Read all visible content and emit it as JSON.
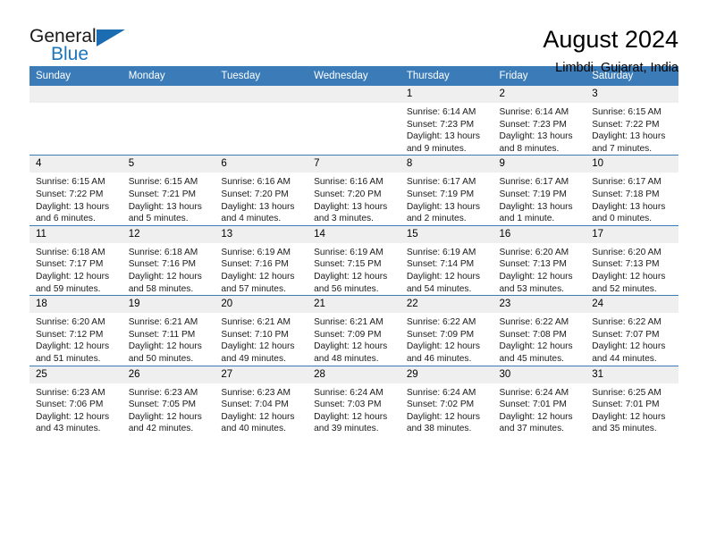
{
  "brand": {
    "name_part1": "General",
    "name_part2": "Blue"
  },
  "header": {
    "title": "August 2024",
    "subtitle": "Limbdi, Gujarat, India"
  },
  "weekday_headers": [
    "Sunday",
    "Monday",
    "Tuesday",
    "Wednesday",
    "Thursday",
    "Friday",
    "Saturday"
  ],
  "colors": {
    "header_blue": "#3b7cb8",
    "logo_blue": "#1b75bb",
    "daynum_bg": "#efefef"
  },
  "weeks": [
    [
      {
        "day": "",
        "empty": true
      },
      {
        "day": "",
        "empty": true
      },
      {
        "day": "",
        "empty": true
      },
      {
        "day": "",
        "empty": true
      },
      {
        "day": "1",
        "sunrise": "Sunrise: 6:14 AM",
        "sunset": "Sunset: 7:23 PM",
        "daylight": "Daylight: 13 hours and 9 minutes."
      },
      {
        "day": "2",
        "sunrise": "Sunrise: 6:14 AM",
        "sunset": "Sunset: 7:23 PM",
        "daylight": "Daylight: 13 hours and 8 minutes."
      },
      {
        "day": "3",
        "sunrise": "Sunrise: 6:15 AM",
        "sunset": "Sunset: 7:22 PM",
        "daylight": "Daylight: 13 hours and 7 minutes."
      }
    ],
    [
      {
        "day": "4",
        "sunrise": "Sunrise: 6:15 AM",
        "sunset": "Sunset: 7:22 PM",
        "daylight": "Daylight: 13 hours and 6 minutes."
      },
      {
        "day": "5",
        "sunrise": "Sunrise: 6:15 AM",
        "sunset": "Sunset: 7:21 PM",
        "daylight": "Daylight: 13 hours and 5 minutes."
      },
      {
        "day": "6",
        "sunrise": "Sunrise: 6:16 AM",
        "sunset": "Sunset: 7:20 PM",
        "daylight": "Daylight: 13 hours and 4 minutes."
      },
      {
        "day": "7",
        "sunrise": "Sunrise: 6:16 AM",
        "sunset": "Sunset: 7:20 PM",
        "daylight": "Daylight: 13 hours and 3 minutes."
      },
      {
        "day": "8",
        "sunrise": "Sunrise: 6:17 AM",
        "sunset": "Sunset: 7:19 PM",
        "daylight": "Daylight: 13 hours and 2 minutes."
      },
      {
        "day": "9",
        "sunrise": "Sunrise: 6:17 AM",
        "sunset": "Sunset: 7:19 PM",
        "daylight": "Daylight: 13 hours and 1 minute."
      },
      {
        "day": "10",
        "sunrise": "Sunrise: 6:17 AM",
        "sunset": "Sunset: 7:18 PM",
        "daylight": "Daylight: 13 hours and 0 minutes."
      }
    ],
    [
      {
        "day": "11",
        "sunrise": "Sunrise: 6:18 AM",
        "sunset": "Sunset: 7:17 PM",
        "daylight": "Daylight: 12 hours and 59 minutes."
      },
      {
        "day": "12",
        "sunrise": "Sunrise: 6:18 AM",
        "sunset": "Sunset: 7:16 PM",
        "daylight": "Daylight: 12 hours and 58 minutes."
      },
      {
        "day": "13",
        "sunrise": "Sunrise: 6:19 AM",
        "sunset": "Sunset: 7:16 PM",
        "daylight": "Daylight: 12 hours and 57 minutes."
      },
      {
        "day": "14",
        "sunrise": "Sunrise: 6:19 AM",
        "sunset": "Sunset: 7:15 PM",
        "daylight": "Daylight: 12 hours and 56 minutes."
      },
      {
        "day": "15",
        "sunrise": "Sunrise: 6:19 AM",
        "sunset": "Sunset: 7:14 PM",
        "daylight": "Daylight: 12 hours and 54 minutes."
      },
      {
        "day": "16",
        "sunrise": "Sunrise: 6:20 AM",
        "sunset": "Sunset: 7:13 PM",
        "daylight": "Daylight: 12 hours and 53 minutes."
      },
      {
        "day": "17",
        "sunrise": "Sunrise: 6:20 AM",
        "sunset": "Sunset: 7:13 PM",
        "daylight": "Daylight: 12 hours and 52 minutes."
      }
    ],
    [
      {
        "day": "18",
        "sunrise": "Sunrise: 6:20 AM",
        "sunset": "Sunset: 7:12 PM",
        "daylight": "Daylight: 12 hours and 51 minutes."
      },
      {
        "day": "19",
        "sunrise": "Sunrise: 6:21 AM",
        "sunset": "Sunset: 7:11 PM",
        "daylight": "Daylight: 12 hours and 50 minutes."
      },
      {
        "day": "20",
        "sunrise": "Sunrise: 6:21 AM",
        "sunset": "Sunset: 7:10 PM",
        "daylight": "Daylight: 12 hours and 49 minutes."
      },
      {
        "day": "21",
        "sunrise": "Sunrise: 6:21 AM",
        "sunset": "Sunset: 7:09 PM",
        "daylight": "Daylight: 12 hours and 48 minutes."
      },
      {
        "day": "22",
        "sunrise": "Sunrise: 6:22 AM",
        "sunset": "Sunset: 7:09 PM",
        "daylight": "Daylight: 12 hours and 46 minutes."
      },
      {
        "day": "23",
        "sunrise": "Sunrise: 6:22 AM",
        "sunset": "Sunset: 7:08 PM",
        "daylight": "Daylight: 12 hours and 45 minutes."
      },
      {
        "day": "24",
        "sunrise": "Sunrise: 6:22 AM",
        "sunset": "Sunset: 7:07 PM",
        "daylight": "Daylight: 12 hours and 44 minutes."
      }
    ],
    [
      {
        "day": "25",
        "sunrise": "Sunrise: 6:23 AM",
        "sunset": "Sunset: 7:06 PM",
        "daylight": "Daylight: 12 hours and 43 minutes."
      },
      {
        "day": "26",
        "sunrise": "Sunrise: 6:23 AM",
        "sunset": "Sunset: 7:05 PM",
        "daylight": "Daylight: 12 hours and 42 minutes."
      },
      {
        "day": "27",
        "sunrise": "Sunrise: 6:23 AM",
        "sunset": "Sunset: 7:04 PM",
        "daylight": "Daylight: 12 hours and 40 minutes."
      },
      {
        "day": "28",
        "sunrise": "Sunrise: 6:24 AM",
        "sunset": "Sunset: 7:03 PM",
        "daylight": "Daylight: 12 hours and 39 minutes."
      },
      {
        "day": "29",
        "sunrise": "Sunrise: 6:24 AM",
        "sunset": "Sunset: 7:02 PM",
        "daylight": "Daylight: 12 hours and 38 minutes."
      },
      {
        "day": "30",
        "sunrise": "Sunrise: 6:24 AM",
        "sunset": "Sunset: 7:01 PM",
        "daylight": "Daylight: 12 hours and 37 minutes."
      },
      {
        "day": "31",
        "sunrise": "Sunrise: 6:25 AM",
        "sunset": "Sunset: 7:01 PM",
        "daylight": "Daylight: 12 hours and 35 minutes."
      }
    ]
  ]
}
